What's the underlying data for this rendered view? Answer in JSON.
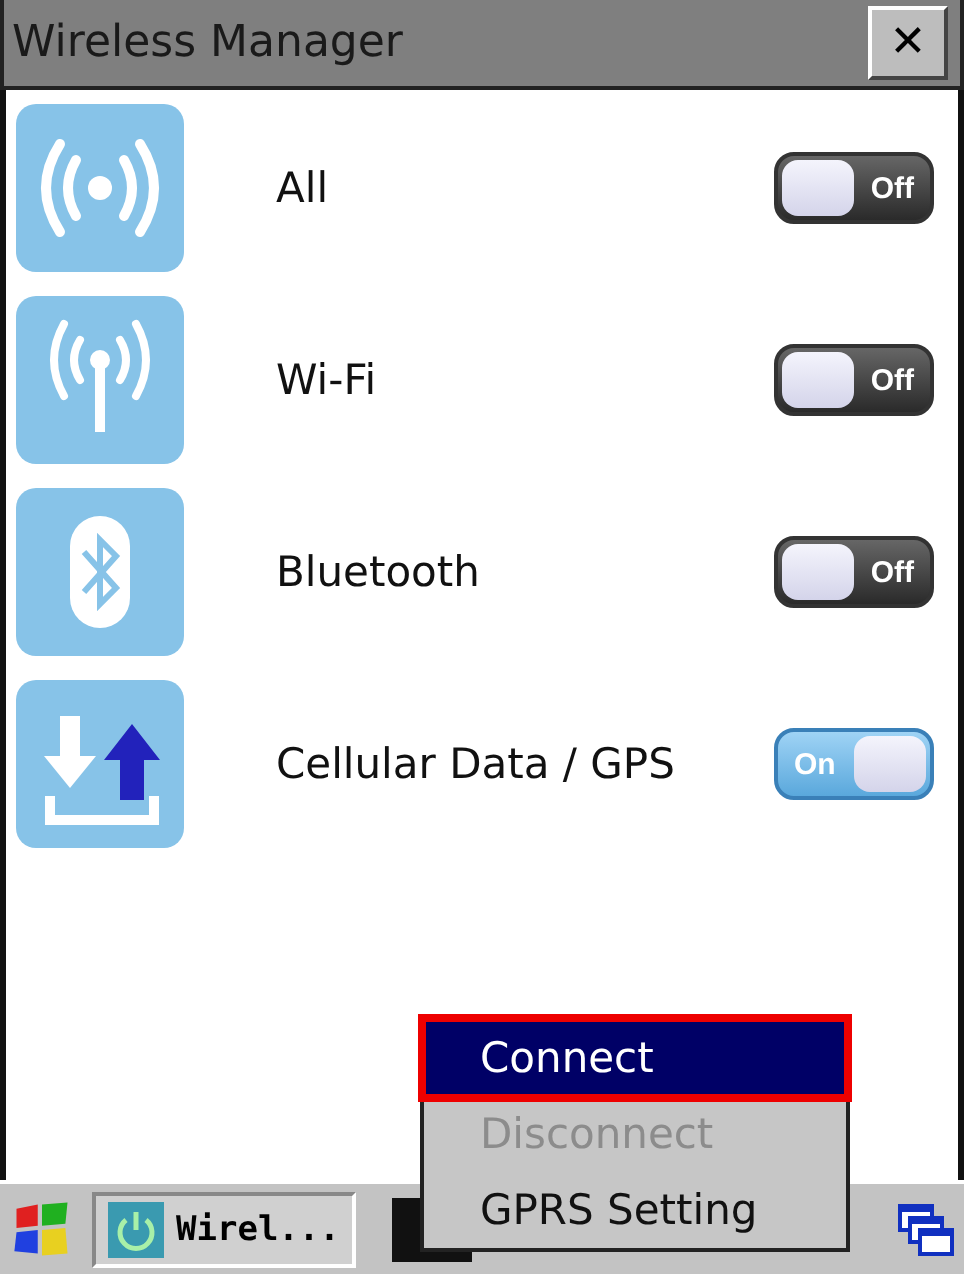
{
  "window": {
    "title": "Wireless Manager",
    "close_label": "✕"
  },
  "radios": [
    {
      "name": "All",
      "kind": "broadcast",
      "on": false,
      "toggle_label": "Off"
    },
    {
      "name": "Wi-Fi",
      "kind": "antenna",
      "on": false,
      "toggle_label": "Off"
    },
    {
      "name": "Bluetooth",
      "kind": "bluetooth",
      "on": false,
      "toggle_label": "Off"
    },
    {
      "name": "Cellular Data / GPS",
      "kind": "cellular",
      "on": true,
      "toggle_label": "On"
    }
  ],
  "menu": {
    "items": [
      {
        "label": "Connect",
        "selected": true,
        "disabled": false,
        "highlighted": true
      },
      {
        "label": "Disconnect",
        "selected": false,
        "disabled": true,
        "highlighted": false
      },
      {
        "label": "GPRS Setting",
        "selected": false,
        "disabled": false,
        "highlighted": false
      }
    ]
  },
  "taskbar": {
    "app_button": "Wirel..."
  }
}
